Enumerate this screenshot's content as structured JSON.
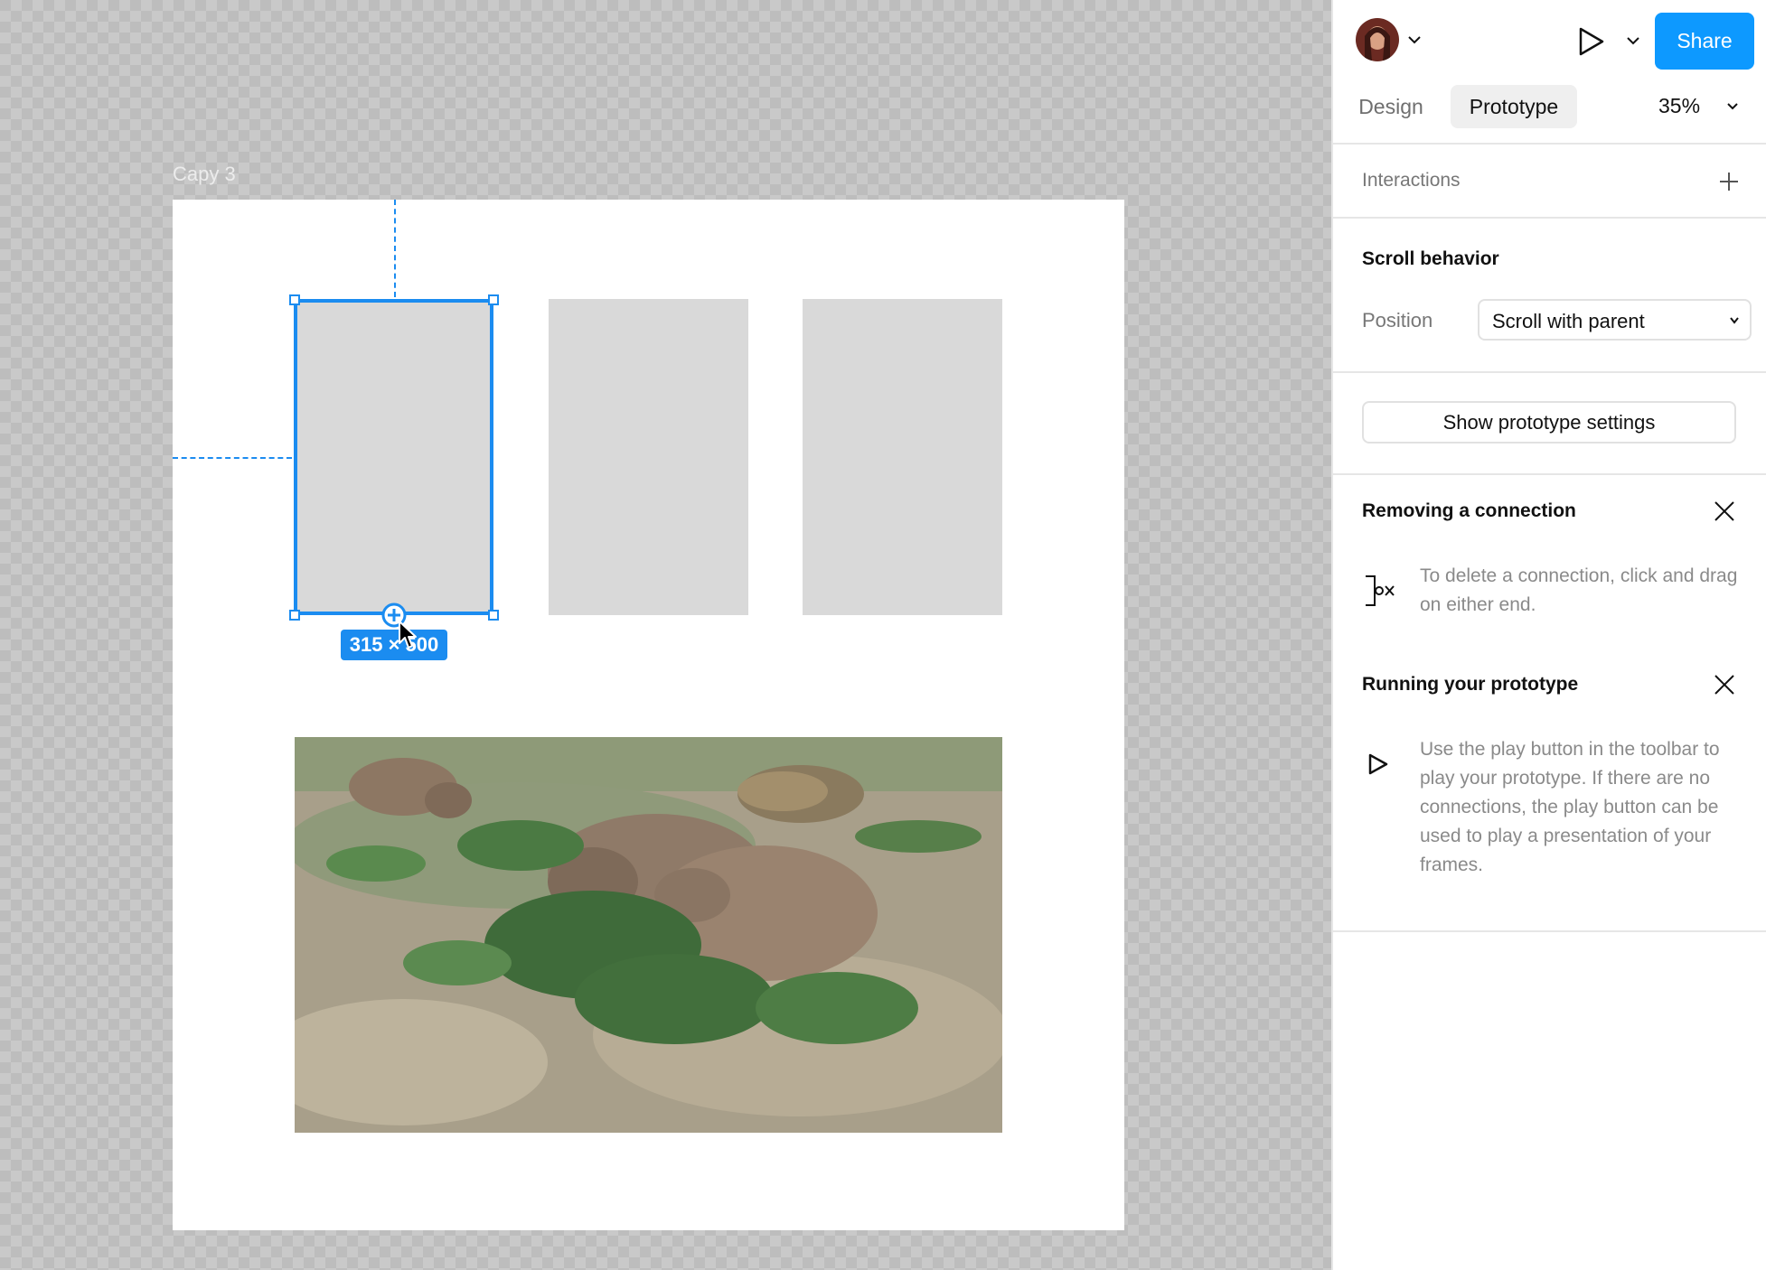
{
  "canvas": {
    "frame_name": "Capy 3",
    "selection_size": "315 × 500"
  },
  "toolbar": {
    "share_label": "Share"
  },
  "tabs": [
    {
      "label": "Design",
      "active": false
    },
    {
      "label": "Prototype",
      "active": true
    }
  ],
  "zoom": "35%",
  "interactions": {
    "title": "Interactions"
  },
  "scroll_behavior": {
    "title": "Scroll behavior",
    "position_label": "Position",
    "position_value": "Scroll with parent"
  },
  "prototype_settings": {
    "button_label": "Show prototype settings"
  },
  "tips": [
    {
      "title": "Removing a connection",
      "icon": "disconnect-icon",
      "text": "To delete a connection, click and drag on either end."
    },
    {
      "title": "Running your prototype",
      "icon": "play-icon",
      "text": "Use the play button in the toolbar to play your prototype. If there are no connections, the play button can be used to play a presentation of your frames."
    }
  ],
  "colors": {
    "accent": "#0d99ff",
    "selection": "#1b8cf0",
    "placeholder": "#d9d9d9"
  }
}
